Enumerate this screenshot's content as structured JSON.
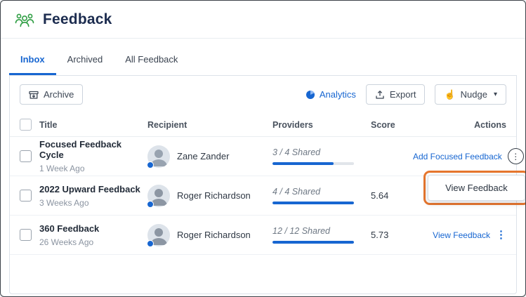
{
  "colors": {
    "accent": "#1766d1",
    "title_navy": "#1c2c4f",
    "logo_green": "#2f9e44",
    "highlight": "#e8772e",
    "progress_track": "#e1e5ea"
  },
  "header": {
    "title": "Feedback"
  },
  "tabs": [
    {
      "label": "Inbox"
    },
    {
      "label": "Archived"
    },
    {
      "label": "All Feedback"
    }
  ],
  "toolbar": {
    "archive": "Archive",
    "analytics": "Analytics",
    "export": "Export",
    "nudge": "Nudge"
  },
  "table": {
    "columns": {
      "title": "Title",
      "recipient": "Recipient",
      "providers": "Providers",
      "score": "Score",
      "actions": "Actions"
    },
    "rows": [
      {
        "title": "Focused Feedback Cycle",
        "age": "1 Week Ago",
        "recipient": "Zane Zander",
        "providers": "3 / 4 Shared",
        "progress": 75,
        "score": "",
        "action": "Add Focused Feedback"
      },
      {
        "title": "2022 Upward Feedback",
        "age": "3 Weeks Ago",
        "recipient": "Roger Richardson",
        "providers": "4 / 4 Shared",
        "progress": 100,
        "score": "5.64",
        "action": "View Feedback"
      },
      {
        "title": "360 Feedback",
        "age": "26 Weeks Ago",
        "recipient": "Roger Richardson",
        "providers": "12 / 12 Shared",
        "progress": 100,
        "score": "5.73",
        "action": "View Feedback"
      }
    ]
  },
  "menu": {
    "view_feedback": "View Feedback"
  }
}
